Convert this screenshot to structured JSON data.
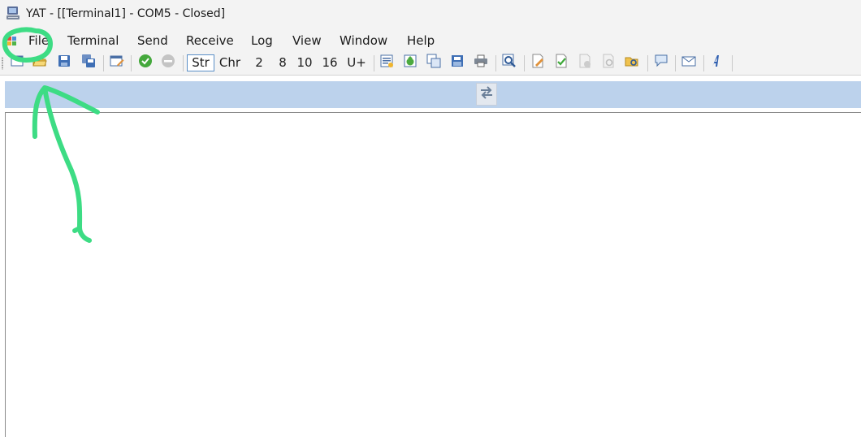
{
  "window": {
    "title": "YAT - [[Terminal1] - COM5 - Closed]"
  },
  "menu": {
    "items": [
      "File",
      "Terminal",
      "Send",
      "Receive",
      "Log",
      "View",
      "Window",
      "Help"
    ]
  },
  "toolbar": {
    "radix_labels": [
      "Str",
      "Chr",
      "2",
      "8",
      "10",
      "16",
      "U+"
    ],
    "active_radix": "Str"
  },
  "colors": {
    "band": "#bcd2ec",
    "annotation": "#3ddc84",
    "selection_border": "#5b8fc7"
  },
  "icons": [
    "new-terminal-icon",
    "open-folder-icon",
    "save-icon",
    "save-all-icon",
    "terminal-settings-icon",
    "open-port-icon",
    "close-port-icon",
    "swap-panels-icon"
  ]
}
